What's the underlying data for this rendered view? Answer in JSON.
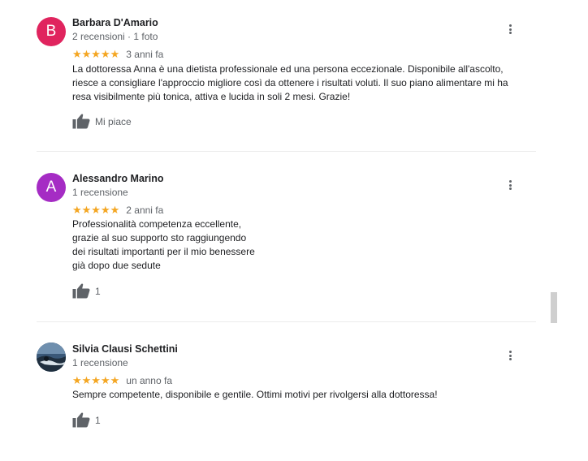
{
  "reviews": [
    {
      "avatar_letter": "B",
      "avatar_color": "#e0245e",
      "name": "Barbara D'Amario",
      "meta": "2 recensioni · 1 foto",
      "stars": "★★★★★",
      "time": "3 anni fa",
      "text_lines": [
        "La dottoressa Anna è una dietista professionale ed una persona eccezionale. Disponibile all'ascolto,",
        "riesce a consigliare l'approccio migliore così da ottenere i risultati voluti. Il suo piano alimentare mi ha",
        "resa visibilmente più tonica, attiva e lucida in soli 2 mesi. Grazie!"
      ],
      "like_label": "Mi piace"
    },
    {
      "avatar_letter": "A",
      "avatar_color": "#a52cc4",
      "name": "Alessandro Marino",
      "meta": "1 recensione",
      "stars": "★★★★★",
      "time": "2 anni fa",
      "text_lines": [
        "Professionalità competenza eccellente,",
        "grazie al suo supporto sto raggiungendo",
        "dei risultati importanti per il mio benessere",
        "già dopo due sedute"
      ],
      "like_label": "1"
    },
    {
      "avatar_letter": "",
      "avatar_color": "#2f4a63",
      "name": "Silvia Clausi Schettini",
      "meta": "1 recensione",
      "stars": "★★★★★",
      "time": "un anno fa",
      "text_lines": [
        "Sempre competente, disponibile e gentile. Ottimi motivi per rivolgersi alla dottoressa!"
      ],
      "like_label": "1"
    }
  ],
  "icons": {
    "menu": "more-vert-icon",
    "like": "thumbs-up-icon"
  },
  "colors": {
    "stars": "#f4a622",
    "secondary_text": "#5f6368"
  }
}
